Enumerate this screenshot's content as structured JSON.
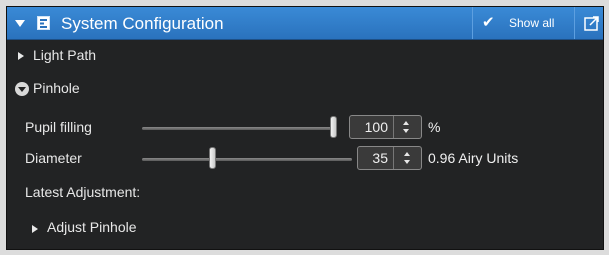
{
  "window": {
    "title": "System Configuration",
    "show_all_label": "Show all"
  },
  "sections": {
    "light_path": "Light Path",
    "pinhole": "Pinhole"
  },
  "pupil_filling": {
    "label": "Pupil filling",
    "value": "100",
    "unit": "%",
    "slider_fraction": 1.0
  },
  "diameter": {
    "label": "Diameter",
    "value": "35",
    "unit": "0.96 Airy Units",
    "slider_fraction": 0.33
  },
  "latest_adjustment": {
    "label": "Latest Adjustment:",
    "action": "Adjust Pinhole"
  },
  "colors": {
    "titlebar": "#2f7fcd",
    "panel_bg": "#222324"
  },
  "icons": {
    "collapse": "triangle-down-icon",
    "config": "document-config-icon",
    "check": "checkmark-icon",
    "undock": "undock-icon"
  }
}
